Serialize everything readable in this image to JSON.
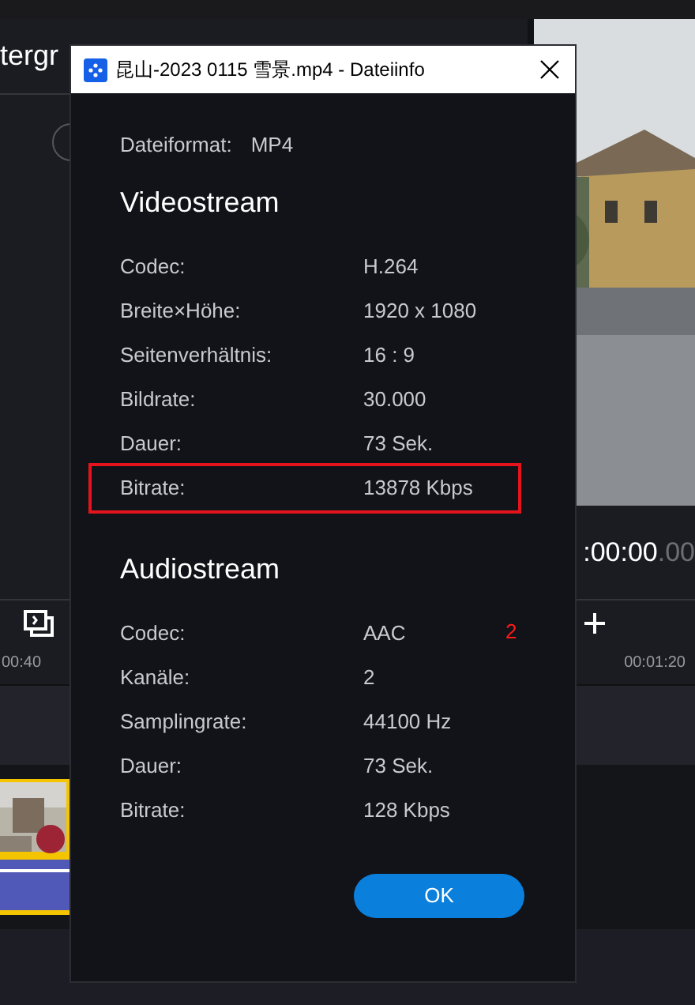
{
  "background_app": {
    "panel_title": "tergr",
    "timecode": ":00:00",
    "timecode_frames": ".00",
    "ruler_labels": [
      "00:40",
      "00:01:20"
    ]
  },
  "dialog": {
    "title": "昆山-2023 0115 雪景.mp4 - Dateiinfo",
    "file_format": {
      "label": "Dateiformat:",
      "value": "MP4"
    },
    "sections": [
      {
        "heading": "Videostream",
        "rows": [
          {
            "label": "Codec:",
            "value": "H.264",
            "highlighted": false
          },
          {
            "label": "Breite×Höhe:",
            "value": "1920 x 1080",
            "highlighted": false
          },
          {
            "label": "Seitenverhältnis:",
            "value": "16 : 9",
            "highlighted": false
          },
          {
            "label": "Bildrate:",
            "value": "30.000",
            "highlighted": false
          },
          {
            "label": "Dauer:",
            "value": "73 Sek.",
            "highlighted": false
          },
          {
            "label": "Bitrate:",
            "value": "13878 Kbps",
            "highlighted": true
          }
        ]
      },
      {
        "heading": "Audiostream",
        "rows": [
          {
            "label": "Codec:",
            "value": "AAC",
            "highlighted": false,
            "annotation": "2"
          },
          {
            "label": "Kanäle:",
            "value": "2",
            "highlighted": false
          },
          {
            "label": "Samplingrate:",
            "value": "44100 Hz",
            "highlighted": false
          },
          {
            "label": "Dauer:",
            "value": "73 Sek.",
            "highlighted": false
          },
          {
            "label": "Bitrate:",
            "value": "128 Kbps",
            "highlighted": false
          }
        ]
      }
    ],
    "ok_button": "OK"
  }
}
